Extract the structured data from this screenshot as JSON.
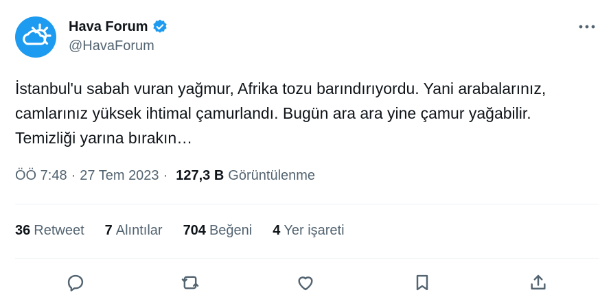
{
  "author": {
    "display_name": "Hava Forum",
    "handle": "@HavaForum",
    "avatar_icon": "sun-cloud-logo",
    "verified_icon": "verified-badge-icon",
    "brand_color": "#1d9bf0"
  },
  "tweet": {
    "text": "İstanbul'u sabah vuran yağmur, Afrika tozu barındırıyordu. Yani arabalarınız, camlarınız yüksek ihtimal çamurlandı. Bugün ara ara yine çamur yağabilir. Temizliği yarına bırakın…",
    "time": "ÖÖ 7:48",
    "date": "27 Tem 2023",
    "separator": "·",
    "views_count": "127,3 B",
    "views_label": "Görüntülenme"
  },
  "stats": [
    {
      "count": "36",
      "label": "Retweet"
    },
    {
      "count": "7",
      "label": "Alıntılar"
    },
    {
      "count": "704",
      "label": "Beğeni"
    },
    {
      "count": "4",
      "label": "Yer işareti"
    }
  ],
  "actions": [
    "reply-icon",
    "retweet-icon",
    "like-icon",
    "bookmark-icon",
    "share-icon"
  ],
  "colors": {
    "text": "#0f1419",
    "secondary": "#536471",
    "divider": "#eff3f4"
  }
}
